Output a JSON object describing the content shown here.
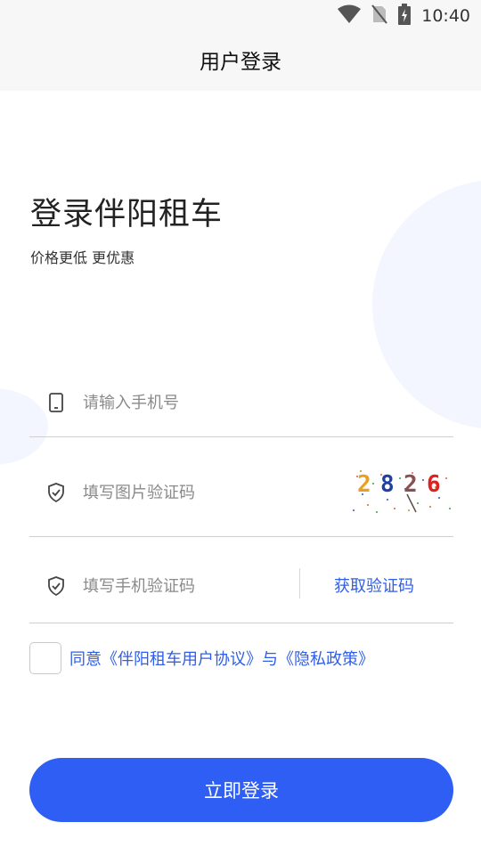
{
  "status_bar": {
    "time": "10:40"
  },
  "header": {
    "title": "用户登录"
  },
  "hero": {
    "title": "登录伴阳租车",
    "subtitle": "价格更低 更优惠"
  },
  "form": {
    "phone": {
      "value": "",
      "placeholder": "请输入手机号"
    },
    "image_code": {
      "value": "",
      "placeholder": "填写图片验证码",
      "captcha_digits": [
        "2",
        "8",
        "2",
        "6"
      ]
    },
    "sms_code": {
      "value": "",
      "placeholder": "填写手机验证码",
      "get_code_label": "获取验证码"
    }
  },
  "agreement": {
    "checked": false,
    "text": "同意《伴阳租车用户协议》与《隐私政策》"
  },
  "login_button": {
    "label": "立即登录"
  },
  "colors": {
    "primary": "#2f5ef5",
    "link": "#2f5ee8",
    "blob": "#f3f5ff"
  }
}
